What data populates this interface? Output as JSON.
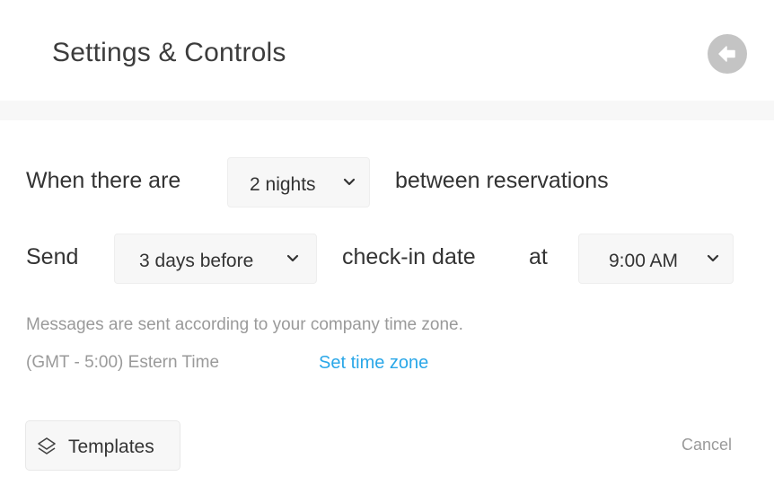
{
  "header": {
    "title": "Settings & Controls",
    "back_icon": "arrow-left-circle-icon"
  },
  "rule": {
    "prefix": "When there are",
    "nights_select": {
      "value": "2 nights"
    },
    "suffix": "between reservations"
  },
  "send": {
    "label": "Send",
    "days_select": {
      "value": "3 days before"
    },
    "middle": "check-in date",
    "at": "at",
    "time_select": {
      "value": "9:00 AM"
    }
  },
  "timezone": {
    "note": "Messages are sent according to your company time zone.",
    "current": "(GMT - 5:00) Estern Time",
    "set_link": "Set time zone"
  },
  "footer": {
    "templates_label": "Templates",
    "templates_icon": "layers-icon",
    "cancel_label": "Cancel"
  },
  "colors": {
    "link": "#2aa7e8",
    "muted_text": "#9a9a9a",
    "control_bg": "#f7f7f7",
    "back_button_bg": "#c4c4c4"
  }
}
